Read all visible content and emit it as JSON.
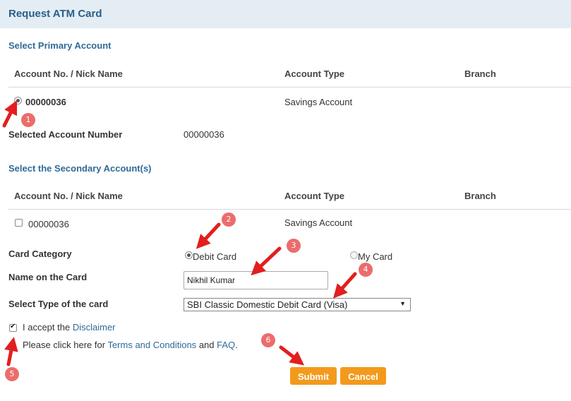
{
  "page_title": "Request ATM Card",
  "primary": {
    "section_title": "Select Primary Account",
    "headers": {
      "account": "Account No. / Nick Name",
      "type": "Account Type",
      "branch": "Branch"
    },
    "row": {
      "account": "00000036",
      "type": "Savings Account"
    },
    "selected_label": "Selected Account Number",
    "selected_value": "00000036"
  },
  "secondary": {
    "section_title": "Select the Secondary Account(s)",
    "headers": {
      "account": "Account No. / Nick Name",
      "type": "Account Type",
      "branch": "Branch"
    },
    "row": {
      "account": "00000036",
      "type": "Savings Account"
    }
  },
  "form": {
    "card_category_label": "Card Category",
    "debit_card": "Debit Card",
    "my_card": "My Card",
    "name_label": "Name on the Card",
    "name_value": "Nikhil Kumar",
    "type_label": "Select Type of the card",
    "type_value": "SBI Classic Domestic Debit Card (Visa)",
    "accept_text": "I accept the",
    "disclaimer": "Disclaimer",
    "click_text": "Please click here for",
    "terms": "Terms and Conditions",
    "and_text": "and",
    "faq": "FAQ",
    "period": "."
  },
  "buttons": {
    "submit": "Submit",
    "cancel": "Cancel"
  },
  "annotations": [
    "1",
    "2",
    "3",
    "4",
    "5",
    "6"
  ],
  "colors": {
    "accent": "#f39a1c",
    "header_bg": "#e3edf3",
    "title": "#2a5e8a",
    "annotation": "#ec6c6c",
    "arrow": "#e31e1e"
  }
}
